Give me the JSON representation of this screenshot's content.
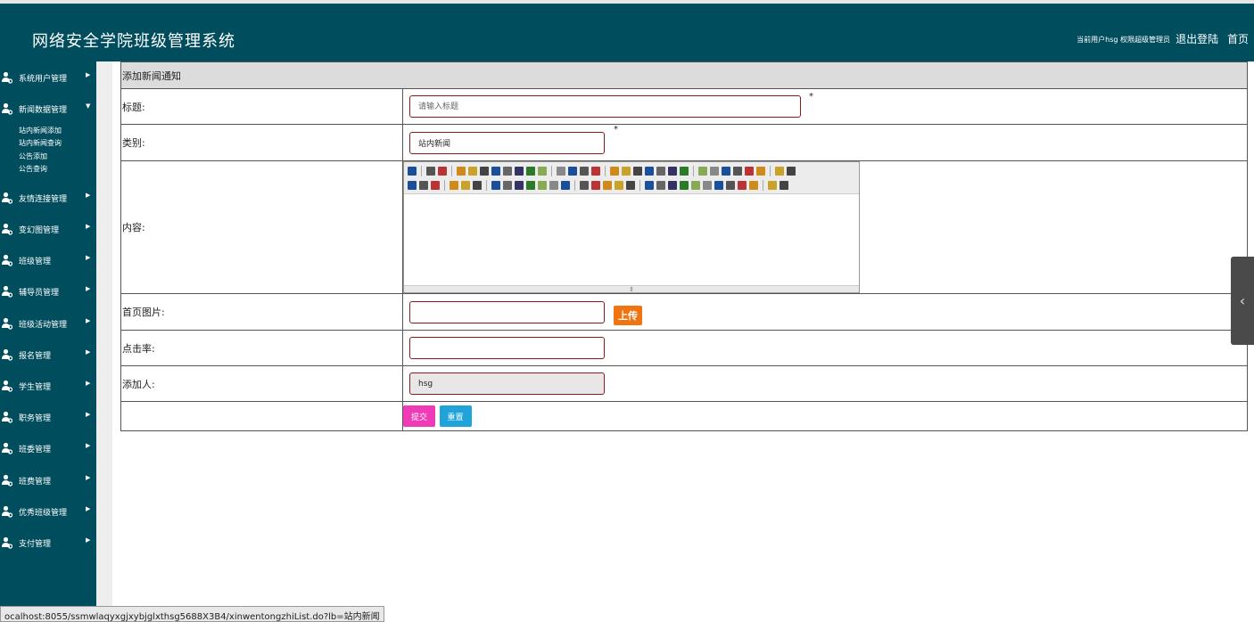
{
  "header": {
    "title": "网络安全学院班级管理系统",
    "user_info": "当前用户hsg 权限超级管理员",
    "logout": "退出登陆",
    "home": "首页"
  },
  "sidebar": {
    "items": [
      {
        "label": "系统用户管理",
        "arrow": "right"
      },
      {
        "label": "新闻数据管理",
        "arrow": "down"
      },
      {
        "label": "友情连接管理",
        "arrow": "right"
      },
      {
        "label": "变幻图管理",
        "arrow": "right"
      },
      {
        "label": "班级管理",
        "arrow": "right"
      },
      {
        "label": "辅导员管理",
        "arrow": "right"
      },
      {
        "label": "班级活动管理",
        "arrow": "right"
      },
      {
        "label": "报名管理",
        "arrow": "right"
      },
      {
        "label": "学生管理",
        "arrow": "right"
      },
      {
        "label": "职务管理",
        "arrow": "right"
      },
      {
        "label": "班委管理",
        "arrow": "right"
      },
      {
        "label": "班费管理",
        "arrow": "right"
      },
      {
        "label": "优秀班级管理",
        "arrow": "right"
      },
      {
        "label": "支付管理",
        "arrow": "right"
      }
    ],
    "subitems": [
      "站内新闻添加",
      "站内新闻查询",
      "公告添加",
      "公告查询"
    ]
  },
  "form": {
    "heading": "添加新闻通知",
    "title_label": "标题:",
    "title_placeholder": "请输入标题",
    "required_mark": "*",
    "category_label": "类别:",
    "category_value": "站内新闻",
    "content_label": "内容:",
    "image_label": "首页图片:",
    "upload_label": "上传",
    "clicks_label": "点击率:",
    "author_label": "添加人:",
    "author_value": "hsg",
    "submit_label": "提交",
    "reset_label": "重置"
  },
  "editor": {
    "toolbar_row1_count": 30,
    "toolbar_row2_count": 30
  },
  "statusbar": {
    "url": "ocalhost:8055/ssmwlaqyxgjxybjglxthsg5688X3B4/xinwentongzhiList.do?lb=站内新闻"
  },
  "colors": {
    "header_bg": "#004d5e",
    "sidebar_bg": "#004d5e",
    "upload_button": "#f07512",
    "submit_button": "#f03bb6",
    "reset_button": "#1fa3d8"
  }
}
